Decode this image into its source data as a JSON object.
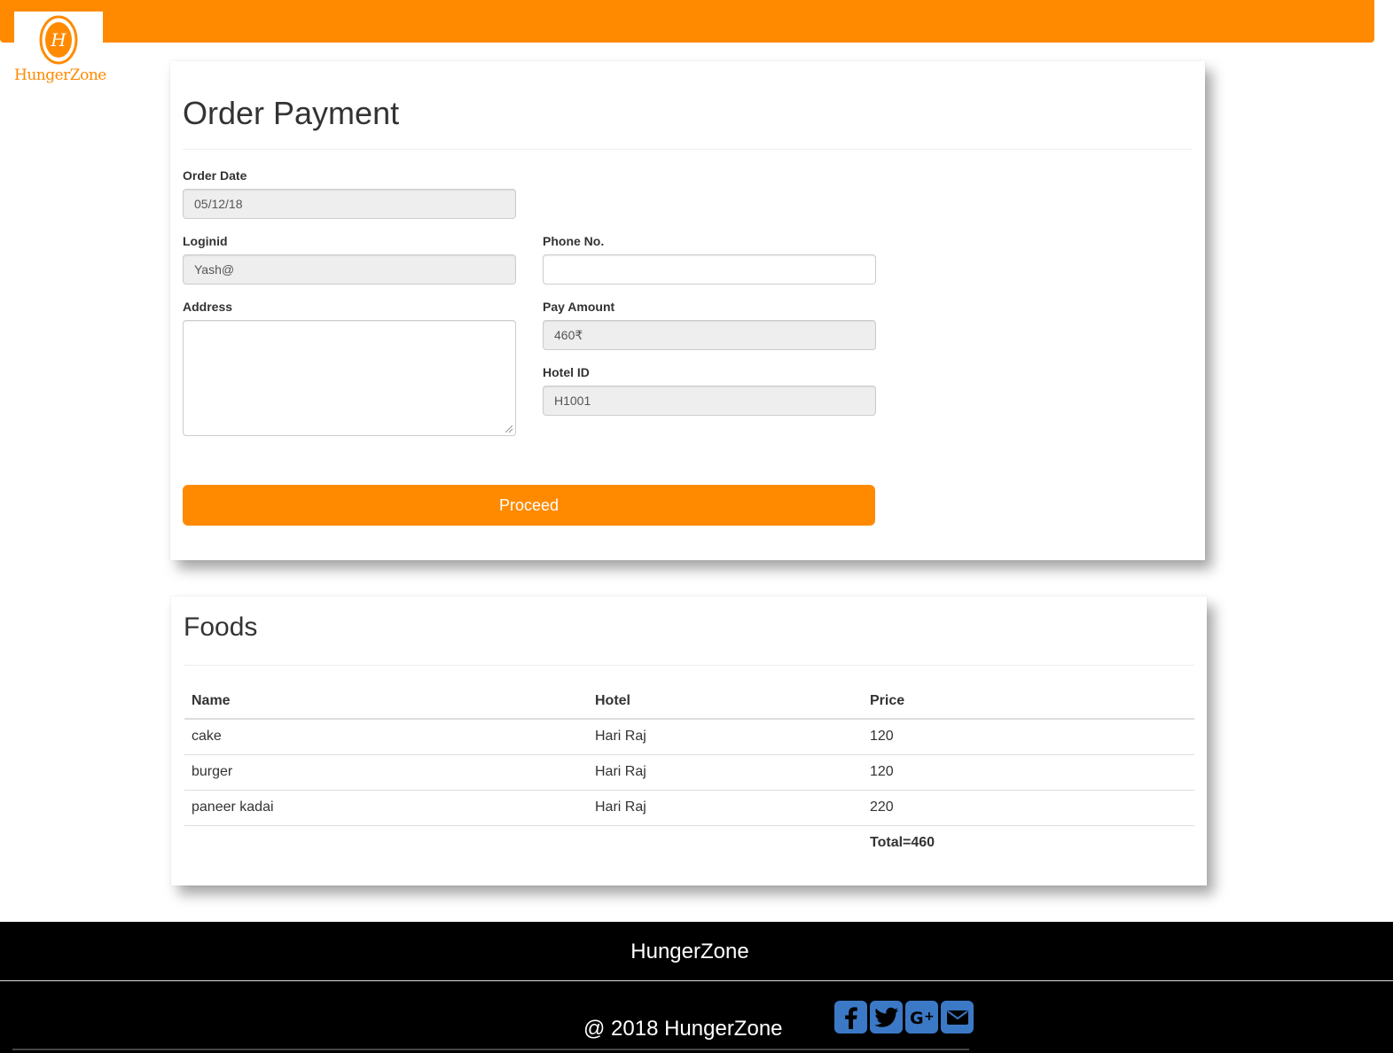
{
  "brand": {
    "logo_letter": "H",
    "logo_text": "HungerZone",
    "accent": "#ff8a00"
  },
  "payment": {
    "title": "Order Payment",
    "fields": {
      "order_date": {
        "label": "Order Date",
        "value": "05/12/18"
      },
      "loginid": {
        "label": "Loginid",
        "value": "Yash@"
      },
      "phone": {
        "label": "Phone No.",
        "value": ""
      },
      "address": {
        "label": "Address",
        "value": ""
      },
      "pay_amount": {
        "label": "Pay Amount",
        "value": "460₹"
      },
      "hotel_id": {
        "label": "Hotel ID",
        "value": "H1001"
      }
    },
    "proceed_label": "Proceed"
  },
  "foods": {
    "title": "Foods",
    "columns": [
      "Name",
      "Hotel",
      "Price"
    ],
    "rows": [
      {
        "name": "cake",
        "hotel": "Hari Raj",
        "price": "120"
      },
      {
        "name": "burger",
        "hotel": "Hari Raj",
        "price": "120"
      },
      {
        "name": "paneer kadai",
        "hotel": "Hari Raj",
        "price": "220"
      }
    ],
    "total": "Total=460"
  },
  "footer": {
    "brand": "HungerZone",
    "copyright": "@ 2018 HungerZone",
    "social_icons": [
      "facebook-icon",
      "twitter-icon",
      "google-plus-icon",
      "email-icon"
    ],
    "social_color": "#3b79c6"
  }
}
